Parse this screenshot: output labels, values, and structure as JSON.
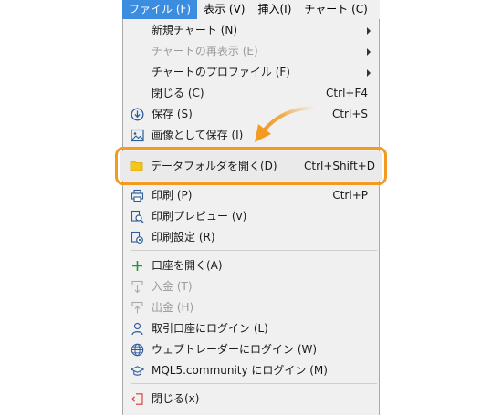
{
  "menubar": {
    "file": "ファイル (F)",
    "view": "表示 (V)",
    "insert": "挿入(I)",
    "chart": "チャート (C)"
  },
  "menu": {
    "new_chart": "新規チャート (N)",
    "redisplay_chart": "チャートの再表示 (E)",
    "chart_profile": "チャートのプロファイル (F)",
    "close": "閉じる (C)",
    "close_shortcut": "Ctrl+F4",
    "save": "保存 (S)",
    "save_shortcut": "Ctrl+S",
    "save_as_picture": "画像として保存 (I)",
    "open_data_folder": "データフォルダを開く(D)",
    "open_data_folder_shortcut": "Ctrl+Shift+D",
    "print": "印刷 (P)",
    "print_shortcut": "Ctrl+P",
    "print_preview": "印刷プレビュー (v)",
    "print_setup": "印刷設定 (R)",
    "open_account": "口座を開く(A)",
    "deposit": "入金 (T)",
    "withdraw": "出金 (H)",
    "login_trade": "取引口座にログイン (L)",
    "login_web": "ウェブトレーダーにログイン (W)",
    "login_community": "MQL5.community にログイン (M)",
    "exit": "閉じる(x)"
  },
  "colors": {
    "highlight_border": "#f39a23",
    "active_menu": "#3c8ce0"
  }
}
